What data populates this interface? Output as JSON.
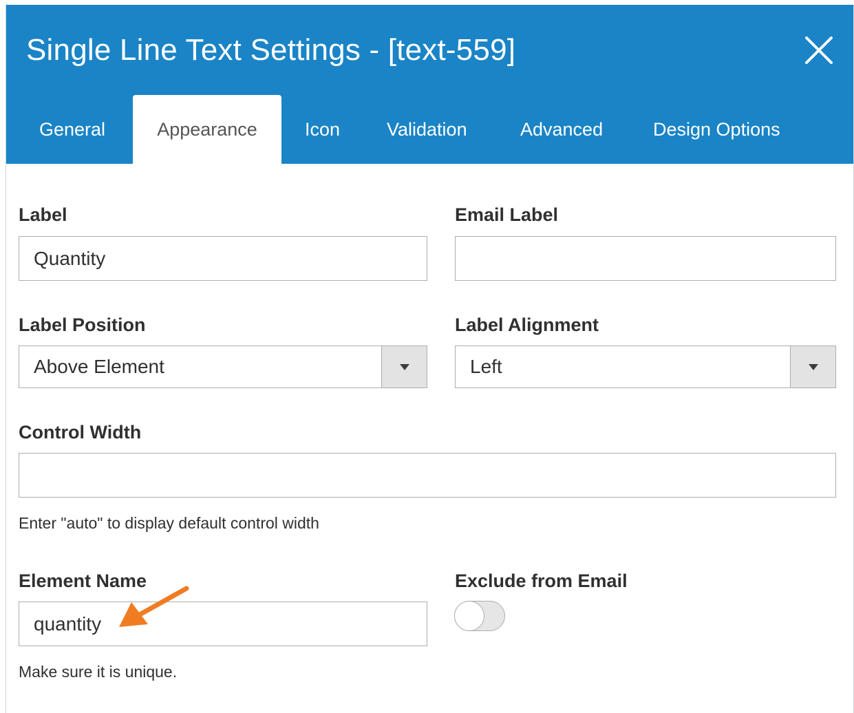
{
  "dialog": {
    "title": "Single Line Text Settings - [text-559]",
    "close_icon": "close-x-icon",
    "header_color": "#1a84c6"
  },
  "tabs": [
    {
      "label": "General",
      "active": false
    },
    {
      "label": "Appearance",
      "active": true
    },
    {
      "label": "Icon",
      "active": false
    },
    {
      "label": "Validation",
      "active": false
    },
    {
      "label": "Advanced",
      "active": false
    },
    {
      "label": "Design Options",
      "active": false
    }
  ],
  "form": {
    "label": {
      "title": "Label",
      "value": "Quantity"
    },
    "email_label": {
      "title": "Email Label",
      "value": ""
    },
    "label_position": {
      "title": "Label Position",
      "value": "Above Element"
    },
    "label_alignment": {
      "title": "Label Alignment",
      "value": "Left"
    },
    "control_width": {
      "title": "Control Width",
      "value": "",
      "help": "Enter \"auto\" to display default control width"
    },
    "element_name": {
      "title": "Element Name",
      "value": "quantity",
      "help": "Make sure it is unique."
    },
    "exclude_from_email": {
      "title": "Exclude from Email",
      "checked": false
    }
  },
  "annotation": {
    "icon": "orange-arrow-icon",
    "color": "#f07c22"
  }
}
